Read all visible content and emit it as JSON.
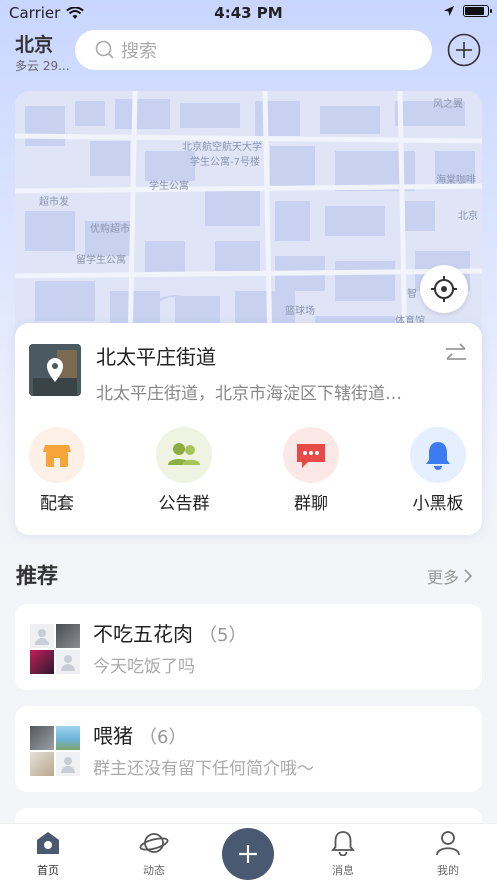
{
  "status_bar": {
    "carrier": "Carrier",
    "time": "4:43 PM",
    "battery_level": 0.9
  },
  "header": {
    "city": "北京",
    "weather": "多云 29...",
    "search_placeholder": "搜索"
  },
  "map": {
    "labels": [
      "风之翼",
      "北京航空航天大学",
      "学生公寓-7号楼",
      "学生公寓",
      "超市发",
      "海棠咖啡",
      "优购超市",
      "北京",
      "留学生公寓",
      "智",
      "篮球场",
      "体育馆"
    ]
  },
  "location": {
    "title": "北太平庄街道",
    "address": "北太平庄街道，北京市海淀区下辖街道…",
    "actions": [
      {
        "label": "配套",
        "icon": "store-icon",
        "bg": "#fdf0e6",
        "color": "#f7a43a"
      },
      {
        "label": "公告群",
        "icon": "group-icon",
        "bg": "#eef3e2",
        "color": "#8cad3f"
      },
      {
        "label": "群聊",
        "icon": "chat-icon",
        "bg": "#fde8e8",
        "color": "#e84a4a"
      },
      {
        "label": "小黑板",
        "icon": "bell-icon",
        "bg": "#e6efff",
        "color": "#3d7cf0"
      }
    ]
  },
  "recommend": {
    "title": "推荐",
    "more": "更多",
    "groups": [
      {
        "name": "不吃五花肉",
        "count": "（5）",
        "desc": "今天吃饭了吗"
      },
      {
        "name": "喂猪",
        "count": "（6）",
        "desc": "群主还没有留下任何简介哦～"
      }
    ]
  },
  "tabs": [
    {
      "label": "首页",
      "icon": "home-icon",
      "active": true
    },
    {
      "label": "动态",
      "icon": "planet-icon",
      "active": false
    },
    {
      "label": "消息",
      "icon": "bell-outline-icon",
      "active": false
    },
    {
      "label": "我的",
      "icon": "user-icon",
      "active": false
    }
  ],
  "colors": {
    "accent": "#4a5972",
    "map_bg": "#dfe5f7"
  }
}
